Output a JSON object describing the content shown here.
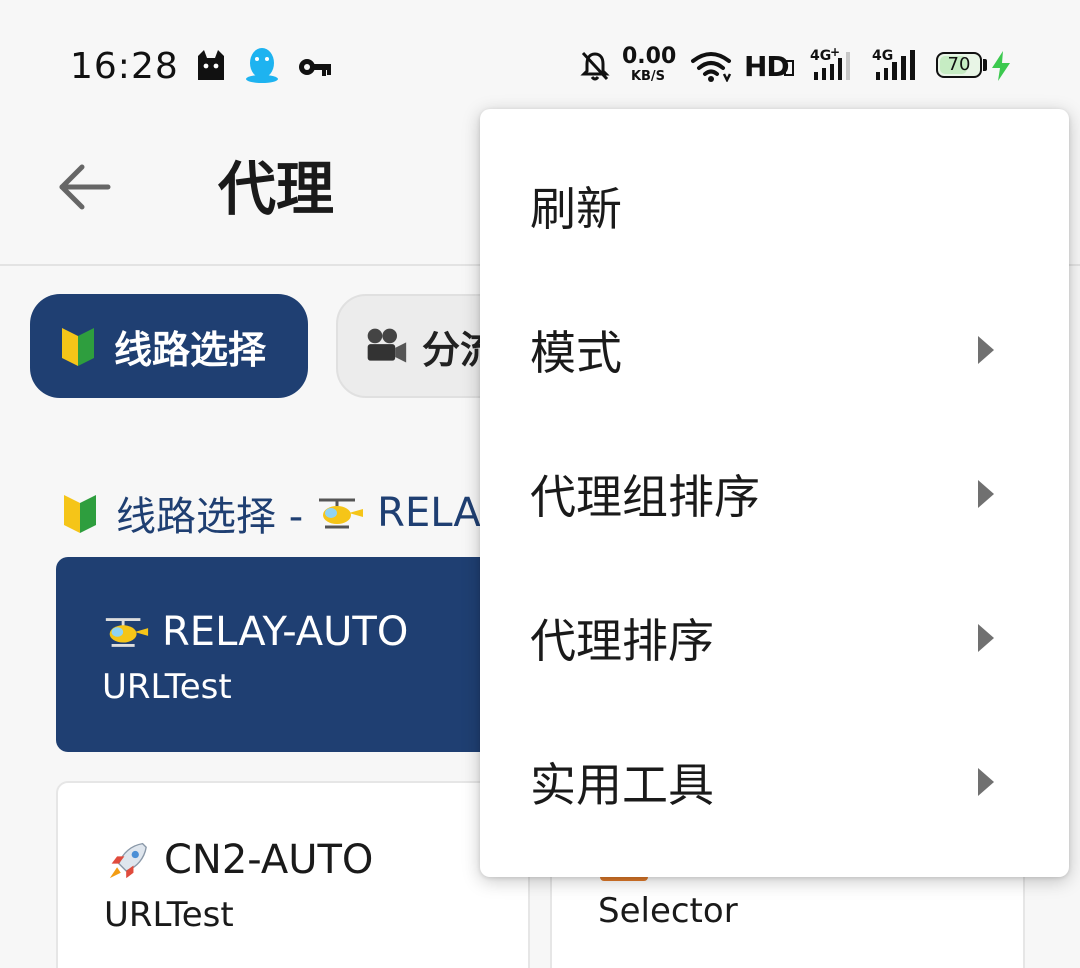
{
  "status_bar": {
    "time": "16:28",
    "net_speed_value": "0.00",
    "net_speed_unit": "KB/S",
    "wifi_label": "HD",
    "battery_level": 70,
    "battery_text": "70",
    "icons": [
      "cat-icon",
      "qq-penguin-icon",
      "vpn-key-icon",
      "bell-muted-icon",
      "wifi-icon",
      "signal-4g-plus-icon",
      "signal-4g-icon",
      "battery-icon",
      "charging-bolt-icon"
    ]
  },
  "app_bar": {
    "title": "代理",
    "back_icon": "arrow-left-icon"
  },
  "chips": [
    {
      "label": "线路选择",
      "emoji": "beginner-icon",
      "active": true
    },
    {
      "label": "分流",
      "emoji": "movie-camera-icon",
      "active": false
    }
  ],
  "group_header": {
    "prefix": "线路选择 -",
    "current": "RELA"
  },
  "cards": [
    {
      "name": "RELAY-AUTO",
      "type": "URLTest",
      "emoji": "helicopter-icon",
      "selected": true
    },
    {
      "name": "CN2-AUTO",
      "type": "URLTest",
      "emoji": "rocket-icon",
      "selected": false
    },
    {
      "name": "",
      "type": "Selector",
      "selected": false
    }
  ],
  "menu": {
    "items": [
      {
        "label": "刷新",
        "submenu": false
      },
      {
        "label": "模式",
        "submenu": true
      },
      {
        "label": "代理组排序",
        "submenu": true
      },
      {
        "label": "代理排序",
        "submenu": true
      },
      {
        "label": "实用工具",
        "submenu": true
      }
    ]
  },
  "colors": {
    "primary": "#1f3f72",
    "background": "#f7f7f7",
    "menu_background": "#ffffff",
    "charging": "#3cc94f",
    "qq": "#1eb3f0"
  }
}
